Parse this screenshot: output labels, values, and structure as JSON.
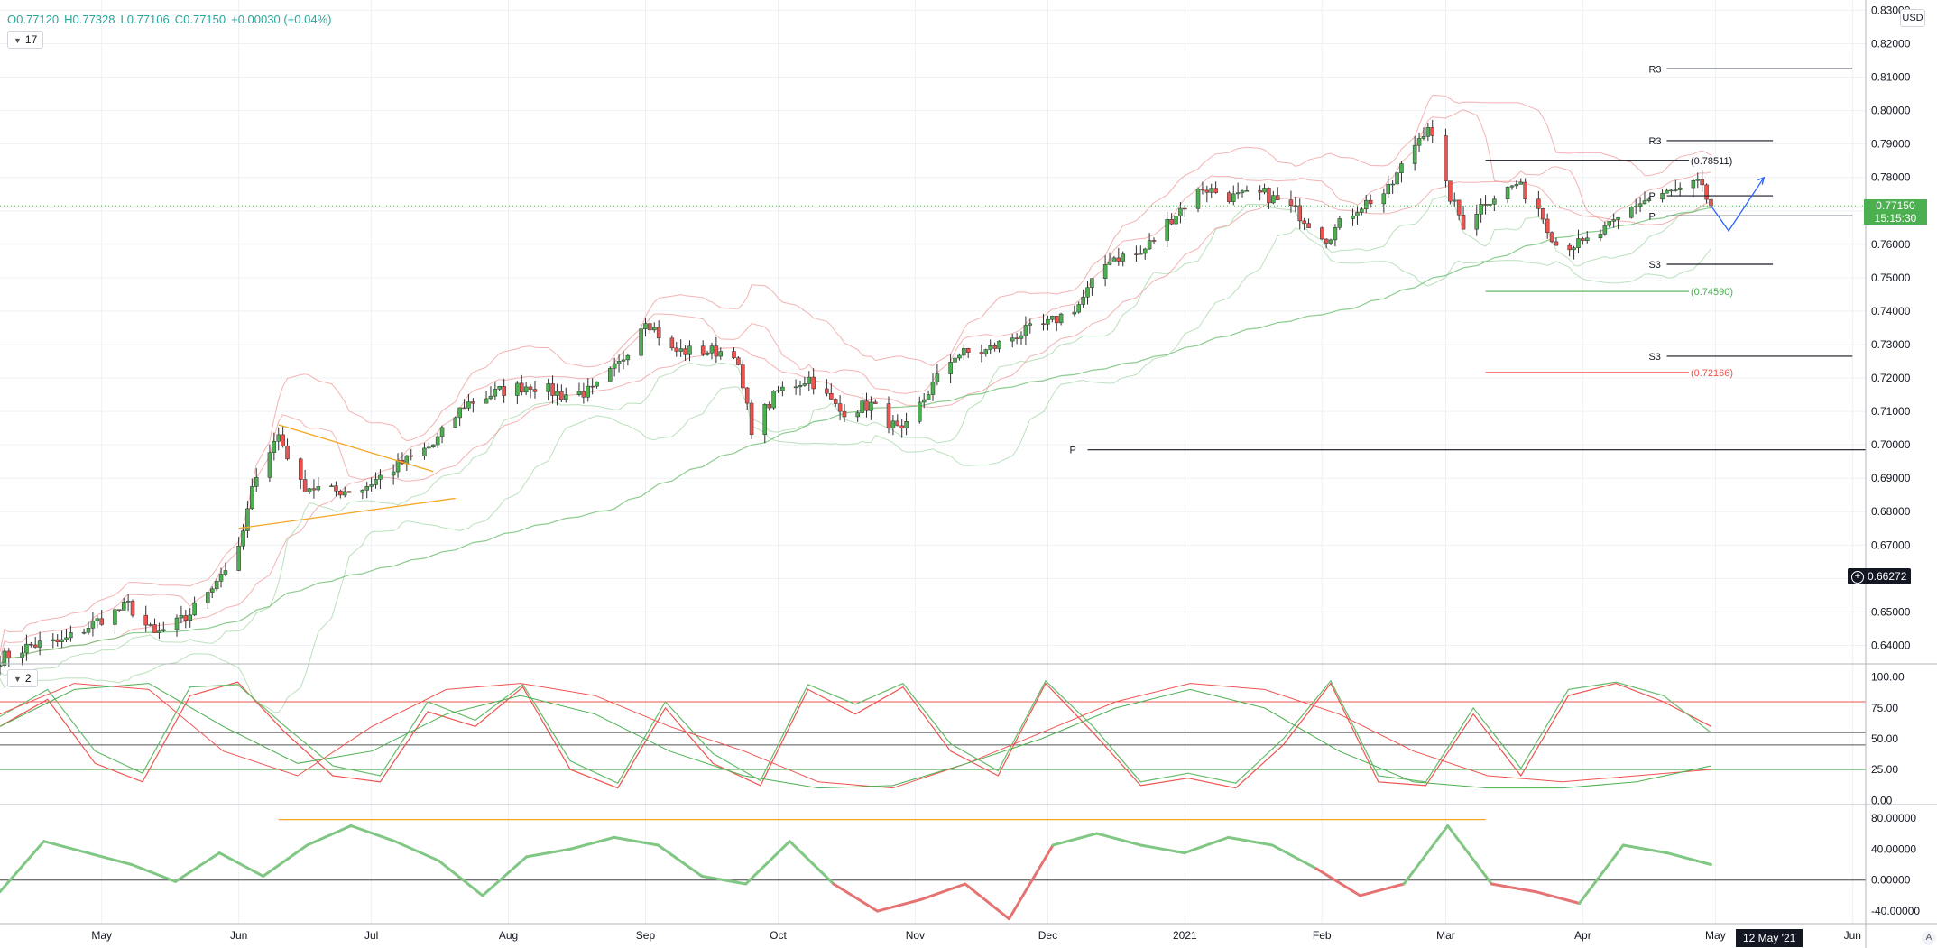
{
  "header": {
    "open": "O0.77120",
    "high": "H0.77328",
    "low": "L0.77106",
    "close": "C0.77150",
    "change": "+0.00030 (+0.04%)",
    "main_badge": "17",
    "osc_badge": "2"
  },
  "currency_label": "USD",
  "last_price": {
    "value": "0.77150",
    "countdown": "15:15:30"
  },
  "crosshair_price": "0.66272",
  "crosshair_date": "12 May '21",
  "auto_label": "A",
  "colors": {
    "up": "#4caf50",
    "down": "#ef5350",
    "green_line": "#66bb6a",
    "red_band": "#ef9a9a",
    "orange": "#f5a623",
    "blue": "#2962ff",
    "dark": "#131722"
  },
  "chart_data": [
    {
      "type": "candlestick",
      "title": "",
      "x": {
        "type": "date",
        "range": [
          "2020-04-08",
          "2021-06-04"
        ],
        "ticks": [
          {
            "date": "2020-05-01",
            "label": "May"
          },
          {
            "date": "2020-06-01",
            "label": "Jun"
          },
          {
            "date": "2020-07-01",
            "label": "Jul"
          },
          {
            "date": "2020-08-01",
            "label": "Aug"
          },
          {
            "date": "2020-09-01",
            "label": "Sep"
          },
          {
            "date": "2020-10-01",
            "label": "Oct"
          },
          {
            "date": "2020-11-01",
            "label": "Nov"
          },
          {
            "date": "2020-12-01",
            "label": "Dec"
          },
          {
            "date": "2021-01-01",
            "label": "2021"
          },
          {
            "date": "2021-02-01",
            "label": "Feb"
          },
          {
            "date": "2021-03-01",
            "label": "Mar"
          },
          {
            "date": "2021-04-01",
            "label": "Apr"
          },
          {
            "date": "2021-05-01",
            "label": "May"
          },
          {
            "date": "2021-06-01",
            "label": "Jun"
          }
        ]
      },
      "y": {
        "range": [
          0.635,
          0.832
        ],
        "ticks": [
          "0.64000",
          "0.65000",
          "0.66000",
          "0.67000",
          "0.68000",
          "0.69000",
          "0.70000",
          "0.71000",
          "0.72000",
          "0.73000",
          "0.74000",
          "0.75000",
          "0.76000",
          "0.77000",
          "0.78000",
          "0.79000",
          "0.80000",
          "0.81000",
          "0.82000",
          "0.83000"
        ]
      },
      "close_path": [
        [
          "2020-04-08",
          0.636
        ],
        [
          "2020-04-15",
          0.64
        ],
        [
          "2020-04-22",
          0.641
        ],
        [
          "2020-05-01",
          0.648
        ],
        [
          "2020-05-07",
          0.652
        ],
        [
          "2020-05-13",
          0.643
        ],
        [
          "2020-05-20",
          0.648
        ],
        [
          "2020-05-27",
          0.66
        ],
        [
          "2020-06-01",
          0.668
        ],
        [
          "2020-06-05",
          0.692
        ],
        [
          "2020-06-10",
          0.703
        ],
        [
          "2020-06-15",
          0.688
        ],
        [
          "2020-06-22",
          0.686
        ],
        [
          "2020-06-29",
          0.687
        ],
        [
          "2020-07-06",
          0.693
        ],
        [
          "2020-07-15",
          0.7
        ],
        [
          "2020-07-22",
          0.712
        ],
        [
          "2020-07-30",
          0.716
        ],
        [
          "2020-08-06",
          0.718
        ],
        [
          "2020-08-13",
          0.715
        ],
        [
          "2020-08-20",
          0.716
        ],
        [
          "2020-08-26",
          0.724
        ],
        [
          "2020-09-01",
          0.738
        ],
        [
          "2020-09-07",
          0.728
        ],
        [
          "2020-09-14",
          0.728
        ],
        [
          "2020-09-21",
          0.728
        ],
        [
          "2020-09-25",
          0.705
        ],
        [
          "2020-10-01",
          0.716
        ],
        [
          "2020-10-08",
          0.72
        ],
        [
          "2020-10-15",
          0.71
        ],
        [
          "2020-10-22",
          0.712
        ],
        [
          "2020-10-29",
          0.703
        ],
        [
          "2020-11-04",
          0.716
        ],
        [
          "2020-11-10",
          0.727
        ],
        [
          "2020-11-17",
          0.728
        ],
        [
          "2020-11-24",
          0.733
        ],
        [
          "2020-12-01",
          0.736
        ],
        [
          "2020-12-08",
          0.742
        ],
        [
          "2020-12-15",
          0.756
        ],
        [
          "2020-12-22",
          0.757
        ],
        [
          "2020-12-29",
          0.768
        ],
        [
          "2021-01-05",
          0.777
        ],
        [
          "2021-01-12",
          0.774
        ],
        [
          "2021-01-19",
          0.775
        ],
        [
          "2021-01-26",
          0.77
        ],
        [
          "2021-02-02",
          0.762
        ],
        [
          "2021-02-09",
          0.771
        ],
        [
          "2021-02-16",
          0.776
        ],
        [
          "2021-02-22",
          0.79
        ],
        [
          "2021-02-25",
          0.796
        ],
        [
          "2021-03-01",
          0.777
        ],
        [
          "2021-03-05",
          0.766
        ],
        [
          "2021-03-10",
          0.773
        ],
        [
          "2021-03-17",
          0.778
        ],
        [
          "2021-03-22",
          0.771
        ],
        [
          "2021-03-26",
          0.76
        ],
        [
          "2021-04-01",
          0.76
        ],
        [
          "2021-04-07",
          0.765
        ],
        [
          "2021-04-13",
          0.772
        ],
        [
          "2021-04-19",
          0.775
        ],
        [
          "2021-04-23",
          0.776
        ],
        [
          "2021-04-27",
          0.778
        ],
        [
          "2021-04-30",
          0.7715
        ]
      ],
      "projection": [
        [
          "2021-04-30",
          0.7715
        ],
        [
          "2021-05-04",
          0.764
        ],
        [
          "2021-05-12",
          0.78
        ]
      ],
      "triangle_lines": [
        [
          [
            "2020-06-10",
            0.706
          ],
          [
            "2020-07-15",
            0.692
          ]
        ],
        [
          [
            "2020-06-01",
            0.675
          ],
          [
            "2020-07-20",
            0.684
          ]
        ]
      ],
      "levels": [
        {
          "label": "R3",
          "value": 0.8125,
          "from": "2021-04-20",
          "to": "2021-06-01"
        },
        {
          "label": "R3",
          "value": 0.791,
          "from": "2021-04-20",
          "to": "2021-05-14"
        },
        {
          "label": "(0.78511)",
          "value": 0.78511,
          "from": "2021-03-10",
          "to": "2021-04-25"
        },
        {
          "label": "P",
          "value": 0.7745,
          "from": "2021-04-20",
          "to": "2021-05-14"
        },
        {
          "label": "P",
          "value": 0.7685,
          "from": "2021-04-20",
          "to": "2021-06-01"
        },
        {
          "label": "S3",
          "value": 0.754,
          "from": "2021-04-20",
          "to": "2021-05-14"
        },
        {
          "label": "(0.74590)",
          "value": 0.7459,
          "from": "2021-03-10",
          "to": "2021-04-25"
        },
        {
          "label": "S3",
          "value": 0.7265,
          "from": "2021-04-20",
          "to": "2021-06-01"
        },
        {
          "label": "(0.72166)",
          "value": 0.72166,
          "from": "2021-03-10",
          "to": "2021-04-25"
        },
        {
          "label": "P",
          "value": 0.6985,
          "from": "2020-12-10",
          "to": "2021-06-04"
        }
      ]
    },
    {
      "type": "line",
      "title": "",
      "y": {
        "range": [
          -2,
          102
        ],
        "ticks": [
          "100.00",
          "75.00",
          "50.00",
          "25.00",
          "0.00"
        ],
        "bands": [
          80,
          55,
          45,
          25
        ]
      },
      "series": [
        {
          "name": "",
          "color": "#ef5350",
          "values": [
            60,
            82,
            30,
            15,
            85,
            96,
            55,
            20,
            15,
            72,
            60,
            92,
            25,
            10,
            75,
            30,
            12,
            90,
            70,
            92,
            40,
            20,
            95,
            55,
            12,
            18,
            10,
            45,
            95,
            15,
            12,
            70,
            20,
            85,
            95,
            80,
            60
          ]
        },
        {
          "name": "",
          "color": "#66bb6a",
          "values": [
            68,
            90,
            40,
            22,
            92,
            94,
            60,
            28,
            20,
            80,
            65,
            94,
            32,
            14,
            80,
            38,
            16,
            94,
            78,
            95,
            46,
            24,
            97,
            60,
            15,
            22,
            14,
            50,
            97,
            20,
            15,
            75,
            26,
            90,
            96,
            85,
            55
          ]
        }
      ]
    },
    {
      "type": "line",
      "title": "",
      "y": {
        "range": [
          -55,
          88
        ],
        "ticks": [
          "80.00000",
          "40.00000",
          "0.00000",
          "-40.00000"
        ],
        "ref_line": 0,
        "level_line": 78
      },
      "series": [
        {
          "name": "",
          "values": [
            -15,
            50,
            35,
            20,
            -2,
            35,
            5,
            45,
            70,
            50,
            25,
            -20,
            30,
            40,
            55,
            45,
            5,
            -5,
            50,
            -5,
            -40,
            -25,
            -5,
            -50,
            45,
            60,
            45,
            35,
            55,
            45,
            15,
            -20,
            -5,
            70,
            -5,
            -15,
            -30,
            45,
            35,
            20
          ]
        }
      ]
    }
  ]
}
